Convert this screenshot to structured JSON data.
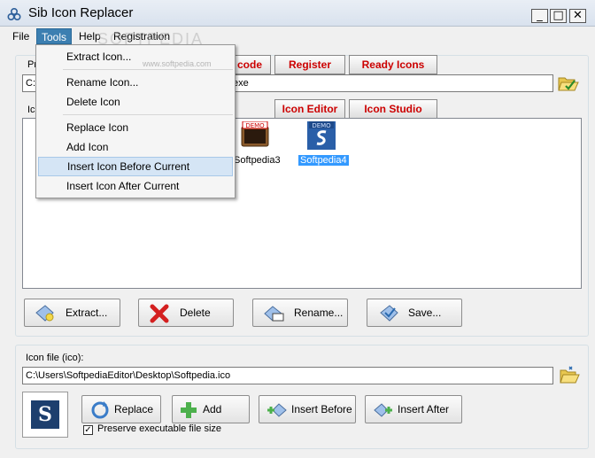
{
  "window": {
    "title": "Sib Icon Replacer",
    "minimize": "_",
    "maximize": "□",
    "close": "✕"
  },
  "watermark": "SOFTPEDIA",
  "menubar": {
    "file": "File",
    "tools": "Tools",
    "help": "Help",
    "registration": "Registration"
  },
  "tools_menu": {
    "items": [
      {
        "label": "Extract Icon..."
      },
      {
        "label": "Rename Icon..."
      },
      {
        "label": "Delete Icon"
      },
      {
        "label": "Replace Icon"
      },
      {
        "label": "Add Icon"
      },
      {
        "label": "Insert Icon Before Current"
      },
      {
        "label": "Insert Icon After Current"
      }
    ],
    "watermark_url": "www.softpedia.com"
  },
  "top_group": {
    "label_fragment": "Pr",
    "code_button": "code",
    "register_button": "Register",
    "ready_icons_button": "Ready Icons",
    "path_prefix": "C:\\",
    "path_suffix": "exe",
    "icons_label_fragment": "Ic",
    "icon_editor_button": "Icon Editor",
    "icon_studio_button": "Icon Studio",
    "icons": [
      {
        "name": "Softpedia3",
        "badge": "DEMO"
      },
      {
        "name": "Softpedia4",
        "badge": "DEMO"
      }
    ],
    "buttons": {
      "extract": "Extract...",
      "delete": "Delete",
      "rename": "Rename...",
      "save": "Save..."
    }
  },
  "bottom_group": {
    "label": "Icon file (ico):",
    "path": "C:\\Users\\SoftpediaEditor\\Desktop\\Softpedia.ico",
    "preview_letter": "S",
    "buttons": {
      "replace": "Replace",
      "add": "Add",
      "insert_before": "Insert Before",
      "insert_after": "Insert After"
    },
    "preserve_label": "Preserve executable file size",
    "preserve_checked": "✓"
  },
  "colors": {
    "accent_red": "#cc0000",
    "selection": "#3399ff",
    "menu_active": "#3c7fb1",
    "preview_bg": "#1d3f6e"
  }
}
